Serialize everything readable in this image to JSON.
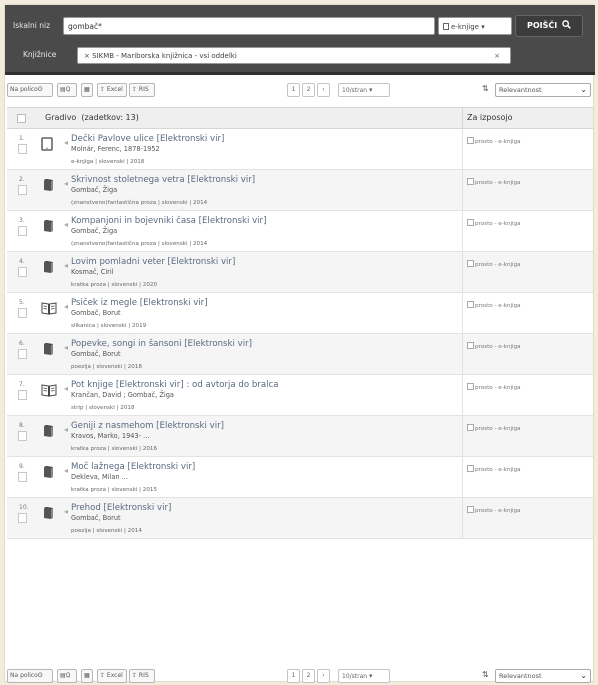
{
  "search": {
    "label": "Iskalni niz",
    "query": "gombač*",
    "type_label": "e-knjige",
    "type_chevron": "▾",
    "button_label": "POIŠČI",
    "libraries_label": "Knjižnice",
    "library_value": "× SIKMB - Mariborska knjižnica - vsi oddelki",
    "library_clear": "×"
  },
  "toolbar": {
    "shelf_label": "Na policoʘ",
    "view_label": "▤Q",
    "excel_label": "⇪ Excel",
    "ris_label": "⇪ RIS",
    "page_1": "1",
    "page_2": "2",
    "page_next": "›",
    "per_page": "10/stran",
    "sort_label": "Relevantnost"
  },
  "table": {
    "title_header": "Gradivo",
    "count_label": "(zadetkov: 13)",
    "loan_header": "Za izposojo",
    "rows": [
      {
        "num": "1.",
        "icon": "tablet-icon",
        "title": "Dečki Pavlove ulice [Elektronski vir]",
        "author": "Molnár, Ferenc, 1878-1952",
        "meta": "e-knjiga | slovenski | 2018",
        "avail": "prosto - e-knjiga"
      },
      {
        "num": "2.",
        "icon": "book-icon",
        "title": "Skrivnost stoletnega vetra [Elektronski vir]",
        "author": "Gombač, Žiga",
        "meta": "(znanstveno)fantastična proza | slovenski | 2014",
        "avail": "prosto - e-knjiga"
      },
      {
        "num": "3.",
        "icon": "book-icon",
        "title": "Kompanjoni in bojevniki časa [Elektronski vir]",
        "author": "Gombač, Žiga",
        "meta": "(znanstveno)fantastična proza | slovenski | 2014",
        "avail": "prosto - e-knjiga"
      },
      {
        "num": "4.",
        "icon": "book-icon",
        "title": "Lovim pomladni veter [Elektronski vir]",
        "author": "Kosmač, Ciril",
        "meta": "kratka proza | slovenski | 2020",
        "avail": "prosto - e-knjiga"
      },
      {
        "num": "5.",
        "icon": "picture-book-icon",
        "title": "Psiček iz megle [Elektronski vir]",
        "author": "Gombač, Borut",
        "meta": "slikanica | slovenski | 2019",
        "avail": "prosto - e-knjiga"
      },
      {
        "num": "6.",
        "icon": "book-icon",
        "title": "Popevke, songi in šansoni [Elektronski vir]",
        "author": "Gombač, Borut",
        "meta": "poezija | slovenski | 2018",
        "avail": "prosto - e-knjiga"
      },
      {
        "num": "7.",
        "icon": "picture-book-icon",
        "title": "Pot knjige [Elektronski vir] : od avtorja do bralca",
        "author": "Krančan, David ; Gombač, Žiga",
        "meta": "strip | slovenski | 2018",
        "avail": "prosto - e-knjiga"
      },
      {
        "num": "8.",
        "icon": "book-icon",
        "title": "Geniji z nasmehom [Elektronski vir]",
        "author": "Kravos, Marko, 1943- ...",
        "meta": "kratka proza | slovenski | 2016",
        "avail": "prosto - e-knjiga"
      },
      {
        "num": "9.",
        "icon": "book-icon",
        "title": "Moč lažnega [Elektronski vir]",
        "author": "Dekleva, Milan ...",
        "meta": "kratka proza | slovenski | 2015",
        "avail": "prosto - e-knjiga"
      },
      {
        "num": "10.",
        "icon": "book-icon",
        "title": "Prehod [Elektronski vir]",
        "author": "Gombač, Borut",
        "meta": "poezija | slovenski | 2014",
        "avail": "prosto - e-knjiga"
      }
    ]
  }
}
